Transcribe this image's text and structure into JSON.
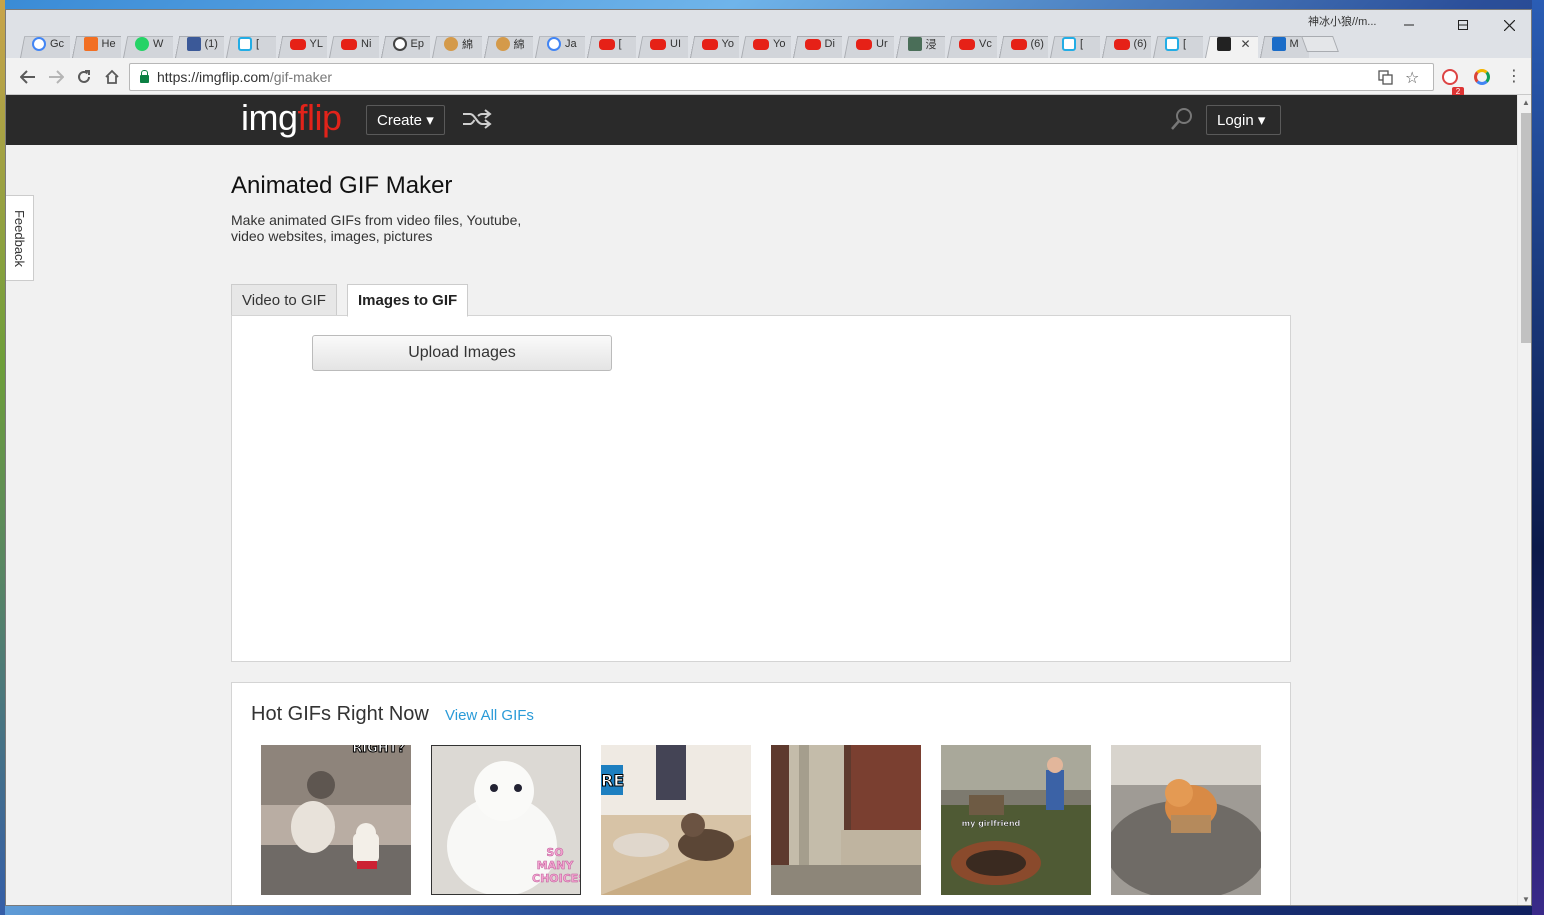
{
  "browser": {
    "profile_name": "神冰小狼//m...",
    "tabs": [
      {
        "favicon": "google-icon",
        "label": "Gc"
      },
      {
        "favicon": "soundcloud-icon",
        "label": "He"
      },
      {
        "favicon": "whatsapp-icon",
        "label": "W"
      },
      {
        "favicon": "facebook-icon",
        "label": "(1)"
      },
      {
        "favicon": "bilibili-icon",
        "label": "["
      },
      {
        "favicon": "youtube-icon",
        "label": "YL"
      },
      {
        "favicon": "youtube-icon",
        "label": "Ni"
      },
      {
        "favicon": "clock-icon",
        "label": "Ep"
      },
      {
        "favicon": "doge-icon",
        "label": "綿"
      },
      {
        "favicon": "doge-icon",
        "label": "綿"
      },
      {
        "favicon": "google-icon",
        "label": "Ja"
      },
      {
        "favicon": "youtube-icon",
        "label": "["
      },
      {
        "favicon": "youtube-icon",
        "label": "UI"
      },
      {
        "favicon": "youtube-icon",
        "label": "Yo"
      },
      {
        "favicon": "youtube-icon",
        "label": "Yo"
      },
      {
        "favicon": "youtube-icon",
        "label": "Di"
      },
      {
        "favicon": "youtube-icon",
        "label": "Ur"
      },
      {
        "favicon": "bird-icon",
        "label": "浸"
      },
      {
        "favicon": "youtube-icon",
        "label": "Vc"
      },
      {
        "favicon": "youtube-icon",
        "label": "(6)"
      },
      {
        "favicon": "bilibili-icon",
        "label": "["
      },
      {
        "favicon": "youtube-icon",
        "label": "(6)"
      },
      {
        "favicon": "bilibili-icon",
        "label": "["
      },
      {
        "favicon": "imgflip-icon",
        "label": "",
        "active": true
      },
      {
        "favicon": "m-icon",
        "label": "M"
      }
    ],
    "url_host": "https://imgflip.com",
    "url_path": "/gif-maker"
  },
  "site": {
    "logo_img": "img",
    "logo_flip": "flip",
    "create_label": "Create ▾",
    "login_label": "Login ▾",
    "feedback_label": "Feedback"
  },
  "page": {
    "title": "Animated GIF Maker",
    "description": "Make animated GIFs from video files, Youtube, video websites, images, pictures",
    "tab_video": "Video to GIF",
    "tab_images": "Images to GIF",
    "upload_label": "Upload Images"
  },
  "hot": {
    "title": "Hot GIFs Right Now",
    "view_all": "View All GIFs",
    "thumbs": [
      {
        "caption": "RIGHT?"
      },
      {
        "caption": "SO MANY CHOICES"
      },
      {
        "caption": "RE"
      },
      {
        "caption": ""
      },
      {
        "caption": "my girlfriend"
      },
      {
        "caption": ""
      }
    ]
  },
  "colors": {
    "header_bg": "#2a2a2a",
    "logo_accent": "#e2231a",
    "link": "#2b9bd8"
  }
}
